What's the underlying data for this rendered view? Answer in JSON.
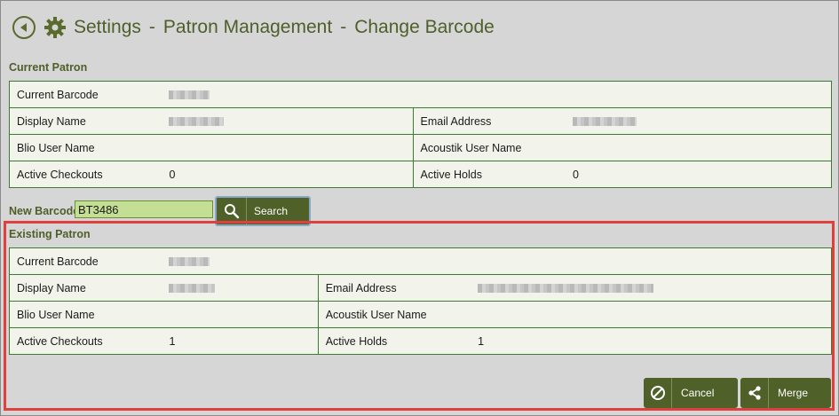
{
  "header": {
    "breadcrumb": [
      "Settings",
      "Patron Management",
      "Change Barcode"
    ],
    "separator": "-",
    "back_icon": "back-arrow-icon",
    "settings_icon": "gear-icon"
  },
  "current_patron": {
    "title": "Current Patron",
    "current_barcode_label": "Current Barcode",
    "display_name_label": "Display Name",
    "email_label": "Email Address",
    "blio_label": "Blio User Name",
    "acoustik_label": "Acoustik User Name",
    "checkouts_label": "Active Checkouts",
    "checkouts_value": "0",
    "holds_label": "Active Holds",
    "holds_value": "0"
  },
  "new_barcode": {
    "label": "New Barcode",
    "value": "BT3486",
    "search_label": "Search",
    "search_icon": "magnifier-icon"
  },
  "existing_patron": {
    "title": "Existing Patron",
    "current_barcode_label": "Current Barcode",
    "display_name_label": "Display Name",
    "email_label": "Email Address",
    "blio_label": "Blio User Name",
    "acoustik_label": "Acoustik User Name",
    "checkouts_label": "Active Checkouts",
    "checkouts_value": "1",
    "holds_label": "Active Holds",
    "holds_value": "1"
  },
  "actions": {
    "cancel_label": "Cancel",
    "merge_label": "Merge",
    "cancel_icon": "cancel-circle-icon",
    "merge_icon": "share-icon"
  },
  "colors": {
    "accent": "#4f6028",
    "table_border": "#3f7a34",
    "highlight": "#e0403c",
    "input_bg": "#c4df94"
  }
}
